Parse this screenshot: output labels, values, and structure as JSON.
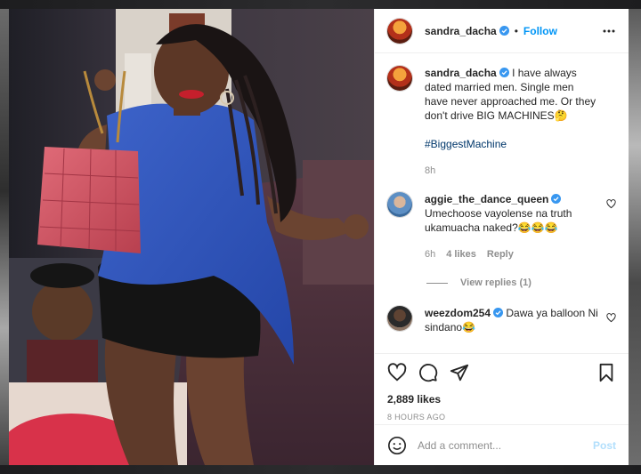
{
  "post": {
    "author": "sandra_dacha",
    "follow_label": "Follow",
    "separator": "•",
    "caption": "I have always dated married men. Single men have never approached me. Or they don't drive BIG MACHINES🤔",
    "hashtag": "#BiggestMachine",
    "caption_age": "8h",
    "likes": "2,889 likes",
    "timestamp": "8 HOURS AGO"
  },
  "comments": [
    {
      "author": "aggie_the_dance_queen",
      "text": "Umechoose vayolense na truth ukamuacha naked?😂😂😂",
      "age": "6h",
      "likes": "4 likes",
      "reply_label": "Reply",
      "view_replies": "View replies (1)"
    },
    {
      "author": "weezdom254",
      "text": "Dawa ya balloon Ni sindano😂"
    }
  ],
  "composer": {
    "placeholder": "Add a comment...",
    "post_label": "Post"
  },
  "colors": {
    "link": "#0095f6",
    "hashtag": "#00376b",
    "muted": "#8e8e8e",
    "post_disabled": "#b2dffc"
  },
  "icons": {
    "verified": "verified-badge-icon",
    "more": "more-options-icon",
    "like": "heart-icon",
    "comment": "comment-bubble-icon",
    "share": "paper-plane-icon",
    "save": "bookmark-icon",
    "emoji": "emoji-smiley-icon"
  }
}
